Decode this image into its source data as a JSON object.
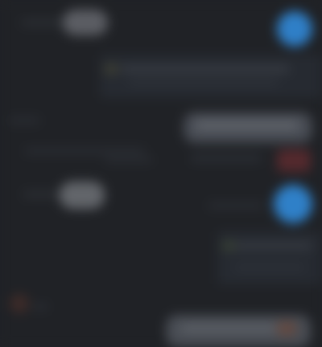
{
  "screen": {
    "theme": "dark",
    "background": "#202226"
  },
  "colors": {
    "avatar_blue": "#2f7fc7",
    "accent_red": "#5a2a2f",
    "surface": "#262a31",
    "pill": "#4a4e55"
  },
  "icons": {
    "avatar_top": "avatar-icon",
    "avatar_mid": "avatar-icon",
    "bottom_left": "emoji-icon"
  }
}
